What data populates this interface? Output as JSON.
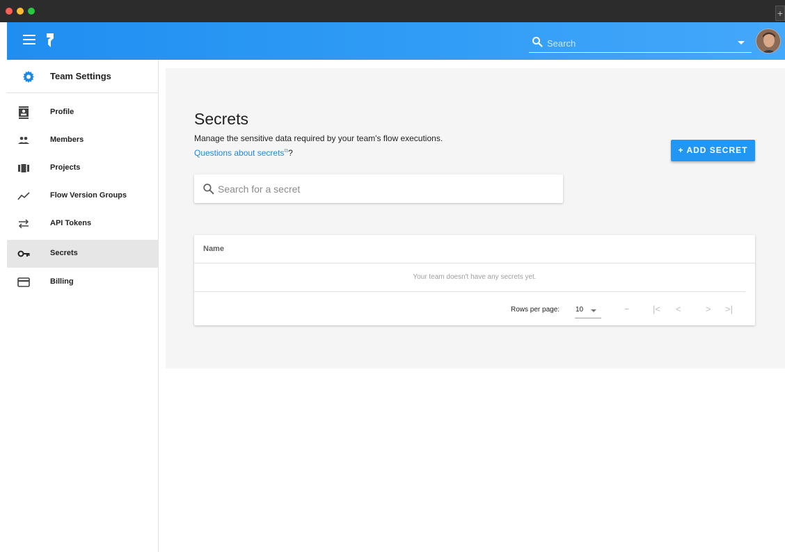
{
  "appbar": {
    "search_placeholder": "Search"
  },
  "sidebar": {
    "header": "Team Settings",
    "items": [
      {
        "label": "Profile",
        "icon": "profile-icon"
      },
      {
        "label": "Members",
        "icon": "members-icon"
      },
      {
        "label": "Projects",
        "icon": "projects-icon"
      },
      {
        "label": "Flow Version Groups",
        "icon": "trend-icon"
      },
      {
        "label": "API Tokens",
        "icon": "swap-arrows-icon"
      },
      {
        "label": "Secrets",
        "icon": "key-icon",
        "active": true
      },
      {
        "label": "Billing",
        "icon": "credit-card-icon"
      }
    ]
  },
  "main": {
    "title": "Secrets",
    "description": "Manage the sensitive data required by your team's flow executions.",
    "help_link": "Questions about secrets",
    "help_suffix": "?",
    "add_button": "+  ADD SECRET",
    "search_placeholder": "Search for a secret",
    "table": {
      "columns": [
        "Name"
      ],
      "empty_message": "Your team doesn't have any secrets yet.",
      "rows_per_page_label": "Rows per page:",
      "rows_per_page_value": "10",
      "range_text": "–",
      "pager": {
        "first": "|<",
        "prev": "<",
        "next": ">",
        "last": ">|"
      }
    }
  },
  "colors": {
    "appbar_start": "#1f8ef1",
    "appbar_end": "#44a8fb",
    "accent": "#2196f3",
    "link": "#1e88e5",
    "active_item_bg": "#e6e6e6"
  }
}
